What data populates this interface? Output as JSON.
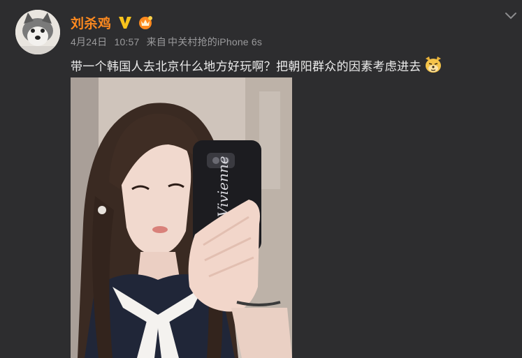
{
  "post": {
    "username": "刘杀鸡",
    "date": "4月24日",
    "time": "10:57",
    "source_prefix": "来自",
    "source_device": "中关村抢的iPhone 6s",
    "text": "带一个韩国人去北京什么地方好玩啊？把朝阳群众的因素考虑进去",
    "emoji_icon": "doge-emoji-icon"
  },
  "photo": {
    "phone_case_text": "Vivienne"
  },
  "colors": {
    "background": "#2d2d2f",
    "username": "#ff8a1f",
    "meta": "#9a9a9c",
    "text": "#ececec",
    "verified": "#f6c21c"
  }
}
